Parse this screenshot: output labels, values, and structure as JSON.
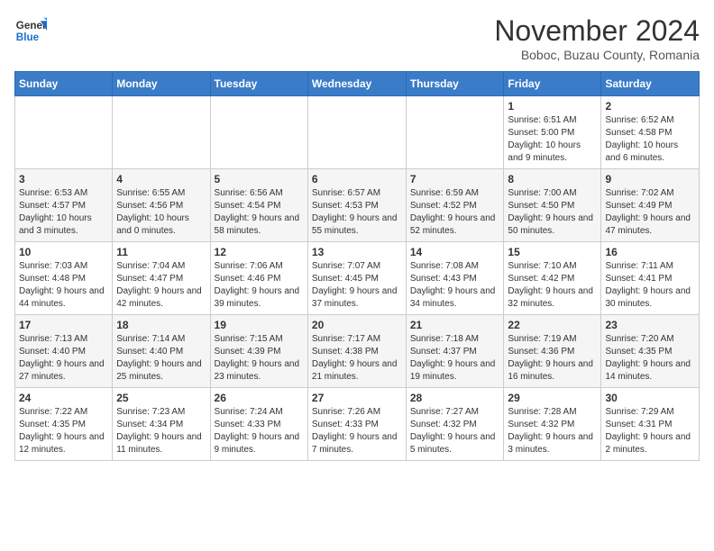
{
  "logo": {
    "line1": "General",
    "line2": "Blue"
  },
  "title": "November 2024",
  "subtitle": "Boboc, Buzau County, Romania",
  "days_of_week": [
    "Sunday",
    "Monday",
    "Tuesday",
    "Wednesday",
    "Thursday",
    "Friday",
    "Saturday"
  ],
  "weeks": [
    [
      {
        "day": "",
        "info": ""
      },
      {
        "day": "",
        "info": ""
      },
      {
        "day": "",
        "info": ""
      },
      {
        "day": "",
        "info": ""
      },
      {
        "day": "",
        "info": ""
      },
      {
        "day": "1",
        "info": "Sunrise: 6:51 AM\nSunset: 5:00 PM\nDaylight: 10 hours and 9 minutes."
      },
      {
        "day": "2",
        "info": "Sunrise: 6:52 AM\nSunset: 4:58 PM\nDaylight: 10 hours and 6 minutes."
      }
    ],
    [
      {
        "day": "3",
        "info": "Sunrise: 6:53 AM\nSunset: 4:57 PM\nDaylight: 10 hours and 3 minutes."
      },
      {
        "day": "4",
        "info": "Sunrise: 6:55 AM\nSunset: 4:56 PM\nDaylight: 10 hours and 0 minutes."
      },
      {
        "day": "5",
        "info": "Sunrise: 6:56 AM\nSunset: 4:54 PM\nDaylight: 9 hours and 58 minutes."
      },
      {
        "day": "6",
        "info": "Sunrise: 6:57 AM\nSunset: 4:53 PM\nDaylight: 9 hours and 55 minutes."
      },
      {
        "day": "7",
        "info": "Sunrise: 6:59 AM\nSunset: 4:52 PM\nDaylight: 9 hours and 52 minutes."
      },
      {
        "day": "8",
        "info": "Sunrise: 7:00 AM\nSunset: 4:50 PM\nDaylight: 9 hours and 50 minutes."
      },
      {
        "day": "9",
        "info": "Sunrise: 7:02 AM\nSunset: 4:49 PM\nDaylight: 9 hours and 47 minutes."
      }
    ],
    [
      {
        "day": "10",
        "info": "Sunrise: 7:03 AM\nSunset: 4:48 PM\nDaylight: 9 hours and 44 minutes."
      },
      {
        "day": "11",
        "info": "Sunrise: 7:04 AM\nSunset: 4:47 PM\nDaylight: 9 hours and 42 minutes."
      },
      {
        "day": "12",
        "info": "Sunrise: 7:06 AM\nSunset: 4:46 PM\nDaylight: 9 hours and 39 minutes."
      },
      {
        "day": "13",
        "info": "Sunrise: 7:07 AM\nSunset: 4:45 PM\nDaylight: 9 hours and 37 minutes."
      },
      {
        "day": "14",
        "info": "Sunrise: 7:08 AM\nSunset: 4:43 PM\nDaylight: 9 hours and 34 minutes."
      },
      {
        "day": "15",
        "info": "Sunrise: 7:10 AM\nSunset: 4:42 PM\nDaylight: 9 hours and 32 minutes."
      },
      {
        "day": "16",
        "info": "Sunrise: 7:11 AM\nSunset: 4:41 PM\nDaylight: 9 hours and 30 minutes."
      }
    ],
    [
      {
        "day": "17",
        "info": "Sunrise: 7:13 AM\nSunset: 4:40 PM\nDaylight: 9 hours and 27 minutes."
      },
      {
        "day": "18",
        "info": "Sunrise: 7:14 AM\nSunset: 4:40 PM\nDaylight: 9 hours and 25 minutes."
      },
      {
        "day": "19",
        "info": "Sunrise: 7:15 AM\nSunset: 4:39 PM\nDaylight: 9 hours and 23 minutes."
      },
      {
        "day": "20",
        "info": "Sunrise: 7:17 AM\nSunset: 4:38 PM\nDaylight: 9 hours and 21 minutes."
      },
      {
        "day": "21",
        "info": "Sunrise: 7:18 AM\nSunset: 4:37 PM\nDaylight: 9 hours and 19 minutes."
      },
      {
        "day": "22",
        "info": "Sunrise: 7:19 AM\nSunset: 4:36 PM\nDaylight: 9 hours and 16 minutes."
      },
      {
        "day": "23",
        "info": "Sunrise: 7:20 AM\nSunset: 4:35 PM\nDaylight: 9 hours and 14 minutes."
      }
    ],
    [
      {
        "day": "24",
        "info": "Sunrise: 7:22 AM\nSunset: 4:35 PM\nDaylight: 9 hours and 12 minutes."
      },
      {
        "day": "25",
        "info": "Sunrise: 7:23 AM\nSunset: 4:34 PM\nDaylight: 9 hours and 11 minutes."
      },
      {
        "day": "26",
        "info": "Sunrise: 7:24 AM\nSunset: 4:33 PM\nDaylight: 9 hours and 9 minutes."
      },
      {
        "day": "27",
        "info": "Sunrise: 7:26 AM\nSunset: 4:33 PM\nDaylight: 9 hours and 7 minutes."
      },
      {
        "day": "28",
        "info": "Sunrise: 7:27 AM\nSunset: 4:32 PM\nDaylight: 9 hours and 5 minutes."
      },
      {
        "day": "29",
        "info": "Sunrise: 7:28 AM\nSunset: 4:32 PM\nDaylight: 9 hours and 3 minutes."
      },
      {
        "day": "30",
        "info": "Sunrise: 7:29 AM\nSunset: 4:31 PM\nDaylight: 9 hours and 2 minutes."
      }
    ]
  ]
}
